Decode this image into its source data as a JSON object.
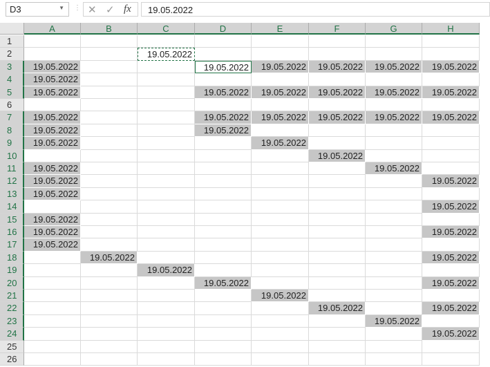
{
  "formula_bar": {
    "name_box": "D3",
    "formula": "19.05.2022",
    "cancel_icon": "x-icon",
    "enter_icon": "check-icon",
    "fx_label": "fx"
  },
  "columns": [
    "A",
    "B",
    "C",
    "D",
    "E",
    "F",
    "G",
    "H"
  ],
  "rows": [
    "1",
    "2",
    "3",
    "4",
    "5",
    "6",
    "7",
    "8",
    "9",
    "10",
    "11",
    "12",
    "13",
    "14",
    "15",
    "16",
    "17",
    "18",
    "19",
    "20",
    "21",
    "22",
    "23",
    "24",
    "25",
    "26"
  ],
  "highlighted_rows": [
    3,
    4,
    5,
    7,
    8,
    9,
    10,
    11,
    12,
    13,
    14,
    15,
    16,
    17,
    18,
    19,
    20,
    21,
    22,
    23,
    24
  ],
  "active_cell": "D3",
  "copy_cell": "C2",
  "cells": {
    "C2": "19.05.2022",
    "A3": "19.05.2022",
    "D3": "19.05.2022",
    "E3": "19.05.2022",
    "F3": "19.05.2022",
    "G3": "19.05.2022",
    "H3": "19.05.2022",
    "A4": "19.05.2022",
    "A5": "19.05.2022",
    "D5": "19.05.2022",
    "E5": "19.05.2022",
    "F5": "19.05.2022",
    "G5": "19.05.2022",
    "H5": "19.05.2022",
    "A7": "19.05.2022",
    "D7": "19.05.2022",
    "E7": "19.05.2022",
    "F7": "19.05.2022",
    "G7": "19.05.2022",
    "H7": "19.05.2022",
    "A8": "19.05.2022",
    "D8": "19.05.2022",
    "A9": "19.05.2022",
    "E9": "19.05.2022",
    "F10": "19.05.2022",
    "A11": "19.05.2022",
    "G11": "19.05.2022",
    "A12": "19.05.2022",
    "H12": "19.05.2022",
    "A13": "19.05.2022",
    "H14": "19.05.2022",
    "A15": "19.05.2022",
    "A16": "19.05.2022",
    "H16": "19.05.2022",
    "A17": "19.05.2022",
    "B18": "19.05.2022",
    "H18": "19.05.2022",
    "C19": "19.05.2022",
    "D20": "19.05.2022",
    "H20": "19.05.2022",
    "E21": "19.05.2022",
    "F22": "19.05.2022",
    "H22": "19.05.2022",
    "G23": "19.05.2022",
    "H24": "19.05.2022"
  }
}
